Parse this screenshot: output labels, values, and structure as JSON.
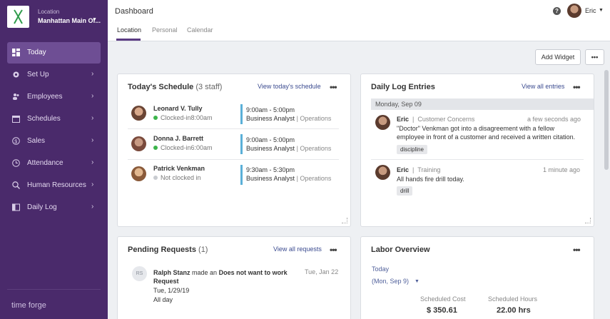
{
  "sidebar": {
    "location_label": "Location",
    "location_name": "Manhattan Main Of...",
    "items": [
      {
        "label": "Today",
        "icon": "dashboard-icon"
      },
      {
        "label": "Set Up",
        "icon": "gear-icon"
      },
      {
        "label": "Employees",
        "icon": "users-icon"
      },
      {
        "label": "Schedules",
        "icon": "calendar-icon"
      },
      {
        "label": "Sales",
        "icon": "dollar-icon"
      },
      {
        "label": "Attendance",
        "icon": "clock-icon"
      },
      {
        "label": "Human Resources",
        "icon": "search-person-icon"
      },
      {
        "label": "Daily Log",
        "icon": "book-icon"
      }
    ],
    "brand": "time forge"
  },
  "header": {
    "title": "Dashboard",
    "tabs": [
      "Location",
      "Personal",
      "Calendar"
    ],
    "user": "Eric"
  },
  "toolbar": {
    "add_widget": "Add Widget",
    "more": "•••"
  },
  "schedule": {
    "title": "Today's Schedule",
    "count": "(3 staff)",
    "link": "View today's schedule",
    "rows": [
      {
        "name": "Leonard V. Tully",
        "status": "Clocked-in8:00am",
        "status_color": "#3cb44b",
        "time": "9:00am - 5:00pm",
        "position": "Business Analyst",
        "dept": "| Operations"
      },
      {
        "name": "Donna J. Barrett",
        "status": "Clocked-in6:00am",
        "status_color": "#3cb44b",
        "time": "9:00am - 5:00pm",
        "position": "Business Analyst",
        "dept": "| Operations"
      },
      {
        "name": "Patrick Venkman",
        "status": "Not clocked in",
        "status_color": "#c8cbd0",
        "time": "9:30am - 5:30pm",
        "position": "Business Analyst",
        "dept": "| Operations"
      }
    ]
  },
  "daily_log": {
    "title": "Daily Log Entries",
    "link": "View all entries",
    "date": "Monday, Sep 09",
    "entries": [
      {
        "author": "Eric",
        "category": "Customer Concerns",
        "time": "a few seconds ago",
        "text": "\"Doctor\" Venkman got into a disagreement with a fellow employee in front of a customer and received a written citation.",
        "tag": "discipline"
      },
      {
        "author": "Eric",
        "category": "Training",
        "time": "1 minute ago",
        "text": "All hands fire drill today.",
        "tag": "drill"
      }
    ]
  },
  "pending": {
    "title": "Pending Requests",
    "count": "(1)",
    "link": "View all requests",
    "request": {
      "initials": "RS",
      "name": "Ralph Stanz",
      "verb": "made an",
      "type": "Does not want to work Request",
      "date": "Tue, Jan 22",
      "for_date": "Tue, 1/29/19",
      "duration": "All day"
    }
  },
  "labor": {
    "title": "Labor Overview",
    "period": "Today",
    "date": "(Mon, Sep 9)",
    "cost_label": "Scheduled Cost",
    "cost_value": "$ 350.61",
    "hours_label": "Scheduled Hours",
    "hours_value": "22.00 hrs"
  },
  "colors": {
    "sidebar_bg": "#4a2a6b",
    "sidebar_active": "#6e4e94",
    "accent": "#5a3a82",
    "shift_bar": "#5bb0d8"
  }
}
